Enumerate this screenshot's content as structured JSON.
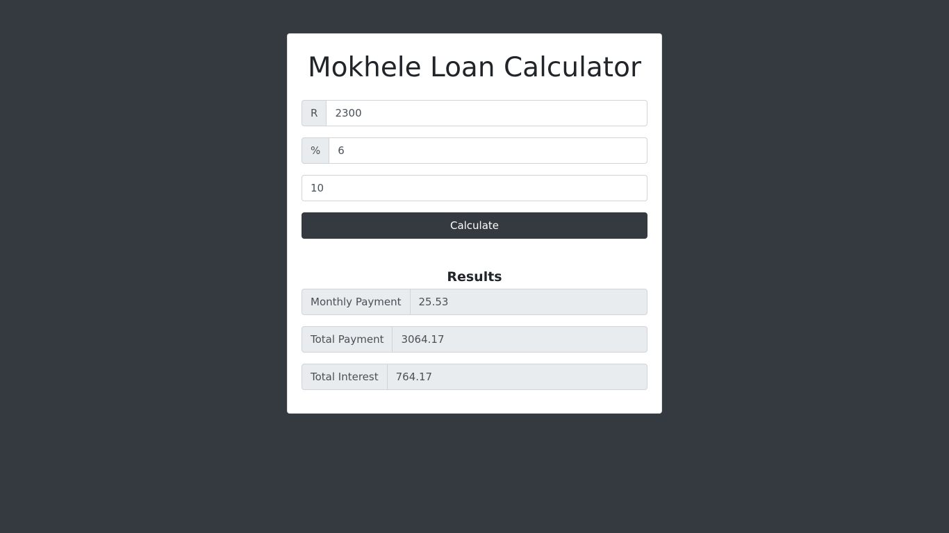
{
  "app": {
    "title": "Mokhele Loan Calculator"
  },
  "form": {
    "amount": {
      "prefix": "R",
      "value": "2300"
    },
    "interest": {
      "prefix": "%",
      "value": "6"
    },
    "years": {
      "value": "10"
    },
    "calculate_label": "Calculate"
  },
  "results": {
    "heading": "Results",
    "monthly_payment": {
      "label": "Monthly Payment",
      "value": "25.53"
    },
    "total_payment": {
      "label": "Total Payment",
      "value": "3064.17"
    },
    "total_interest": {
      "label": "Total Interest",
      "value": "764.17"
    }
  },
  "colors": {
    "page_background": "#343a40",
    "card_background": "#ffffff",
    "button_background": "#343a40",
    "addon_background": "#e9ecef"
  }
}
